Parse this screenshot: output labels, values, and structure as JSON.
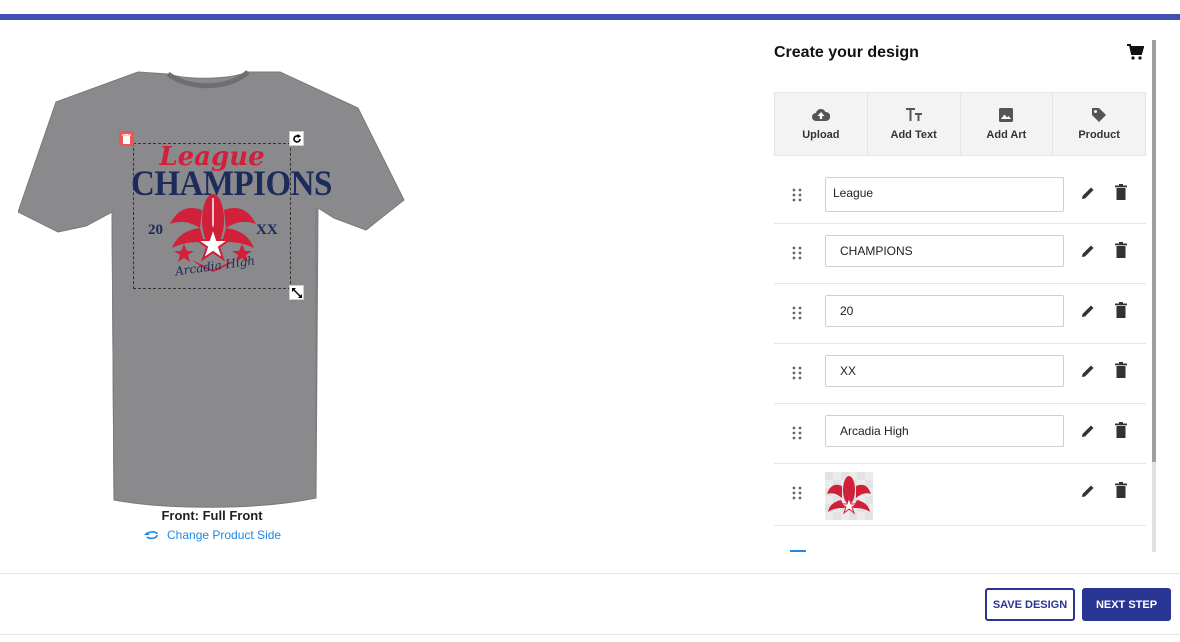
{
  "colors": {
    "accent": "#3f51b5",
    "button_primary": "#283593",
    "link": "#1e88e5",
    "shirt": "#8a8a8d",
    "design_red": "#d0203a",
    "design_navy": "#1c2a5c"
  },
  "canvas": {
    "design": {
      "league": "League",
      "champions": "CHAMPIONS",
      "year_left": "20",
      "year_right": "XX",
      "school": "Arcadia High"
    },
    "side_label": "Front: Full Front",
    "change_side_label": "Change Product Side",
    "icons": {
      "delete": "trash-icon",
      "rotate": "rotate-icon",
      "resize": "resize-icon",
      "change_side": "swap-icon"
    }
  },
  "panel": {
    "title": "Create your design",
    "cart_icon": "cart-icon",
    "tools": [
      {
        "label": "Upload",
        "icon": "cloud-upload-icon"
      },
      {
        "label": "Add Text",
        "icon": "text-icon"
      },
      {
        "label": "Add Art",
        "icon": "image-icon"
      },
      {
        "label": "Product",
        "icon": "tag-icon"
      }
    ],
    "layers": [
      {
        "type": "text",
        "value": "League"
      },
      {
        "type": "text",
        "value": "CHAMPIONS"
      },
      {
        "type": "text",
        "value": "20"
      },
      {
        "type": "text",
        "value": "XX"
      },
      {
        "type": "text",
        "value": "Arcadia High"
      },
      {
        "type": "image"
      }
    ]
  },
  "footer": {
    "save_label": "SAVE DESIGN",
    "next_label": "NEXT STEP"
  }
}
